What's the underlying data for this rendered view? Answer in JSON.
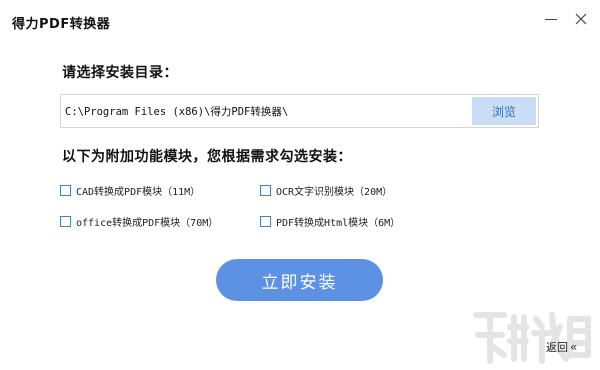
{
  "window": {
    "title": "得力PDF转换器"
  },
  "install_dir": {
    "heading": "请选择安装目录：",
    "path": "C:\\Program Files (x86)\\得力PDF转换器\\",
    "browse_label": "浏览"
  },
  "modules": {
    "heading": "以下为附加功能模块，您根据需求勾选安装：",
    "items": [
      {
        "label": "CAD转换成PDF模块（11M）"
      },
      {
        "label": "OCR文字识别模块（20M）"
      },
      {
        "label": "office转换成PDF模块（70M）"
      },
      {
        "label": "PDF转换成Html模块（6M）"
      }
    ]
  },
  "actions": {
    "install_label": "立即安装",
    "back_label": "返回",
    "back_icon": "«"
  },
  "icons": {
    "minimize": "minimize-icon",
    "close": "close-icon",
    "watermark": "xiazaiba-watermark"
  },
  "colors": {
    "accent": "#5d92e3",
    "browse_bg": "#c9ddf5",
    "browse_text": "#2f6fb8",
    "checkbox_border": "#4a7fc0"
  }
}
